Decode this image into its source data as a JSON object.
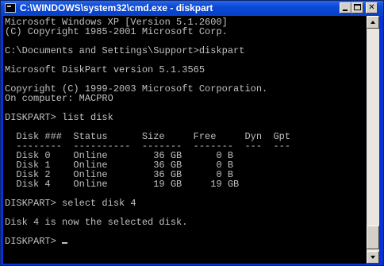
{
  "window": {
    "title": "C:\\WINDOWS\\system32\\cmd.exe - diskpart",
    "minimize_label": "",
    "maximize_label": "",
    "close_label": "✕"
  },
  "colors": {
    "titlebar": "#0a49d6",
    "console_bg": "#000000",
    "console_fg": "#c0c0c0"
  },
  "console": {
    "lines": [
      "Microsoft Windows XP [Version 5.1.2600]",
      "(C) Copyright 1985-2001 Microsoft Corp.",
      "",
      "C:\\Documents and Settings\\Support>diskpart",
      "",
      "Microsoft DiskPart version 5.1.3565",
      "",
      "Copyright (C) 1999-2003 Microsoft Corporation.",
      "On computer: MACPRO",
      "",
      "DISKPART> list disk",
      "",
      "  Disk ###  Status      Size     Free     Dyn  Gpt",
      "  --------  ----------  -------  -------  ---  ---",
      "  Disk 0    Online        36 GB      0 B",
      "  Disk 1    Online        36 GB      0 B",
      "  Disk 2    Online        36 GB      0 B",
      "  Disk 4    Online        19 GB     19 GB",
      "",
      "DISKPART> select disk 4",
      "",
      "Disk 4 is now the selected disk.",
      "",
      "DISKPART> "
    ]
  },
  "icons": {
    "app": "cmd-window-icon",
    "minimize": "minimize-icon",
    "maximize": "maximize-icon",
    "close": "close-icon"
  }
}
